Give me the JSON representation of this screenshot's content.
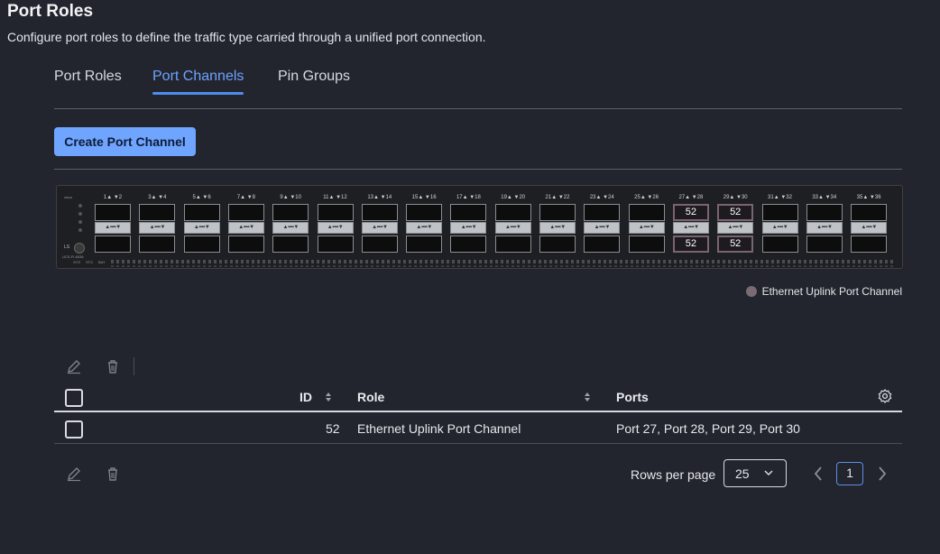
{
  "header": {
    "title": "Port Roles",
    "subtitle": "Configure port roles to define the traffic type carried through a unified port connection."
  },
  "tabs": [
    {
      "label": "Port Roles",
      "active": false
    },
    {
      "label": "Port Channels",
      "active": true
    },
    {
      "label": "Pin Groups",
      "active": false
    }
  ],
  "actions": {
    "create_label": "Create Port Channel"
  },
  "switch": {
    "model": "UCS-FI-6536",
    "ls_label": "LS",
    "led_labels": [
      "SYS",
      "STS",
      "BAY"
    ],
    "port_pairs": [
      {
        "label": "1▲ ▼2",
        "top": "",
        "bottom": ""
      },
      {
        "label": "3▲ ▼4",
        "top": "",
        "bottom": ""
      },
      {
        "label": "5▲ ▼6",
        "top": "",
        "bottom": ""
      },
      {
        "label": "7▲ ▼8",
        "top": "",
        "bottom": ""
      },
      {
        "label": "9▲ ▼10",
        "top": "",
        "bottom": ""
      },
      {
        "label": "11▲ ▼12",
        "top": "",
        "bottom": ""
      },
      {
        "label": "13▲ ▼14",
        "top": "",
        "bottom": ""
      },
      {
        "label": "15▲ ▼16",
        "top": "",
        "bottom": ""
      },
      {
        "label": "17▲ ▼18",
        "top": "",
        "bottom": ""
      },
      {
        "label": "19▲ ▼20",
        "top": "",
        "bottom": ""
      },
      {
        "label": "21▲ ▼22",
        "top": "",
        "bottom": ""
      },
      {
        "label": "23▲ ▼24",
        "top": "",
        "bottom": ""
      },
      {
        "label": "25▲ ▼26",
        "top": "",
        "bottom": ""
      },
      {
        "label": "27▲ ▼28",
        "top": "52",
        "bottom": "52"
      },
      {
        "label": "29▲ ▼30",
        "top": "52",
        "bottom": "52"
      },
      {
        "label": "31▲ ▼32",
        "top": "",
        "bottom": ""
      },
      {
        "label": "33▲ ▼34",
        "top": "",
        "bottom": ""
      },
      {
        "label": "35▲ ▼36",
        "top": "",
        "bottom": ""
      }
    ]
  },
  "legend": {
    "label": "Ethernet Uplink Port Channel",
    "color": "#7a6a74"
  },
  "table": {
    "columns": {
      "id": "ID",
      "role": "Role",
      "ports": "Ports"
    },
    "rows": [
      {
        "id": "52",
        "role": "Ethernet Uplink Port Channel",
        "ports": "Port 27, Port 28, Port 29, Port 30"
      }
    ]
  },
  "pagination": {
    "rows_per_page_label": "Rows per page",
    "rows_per_page_value": "25",
    "current_page": "1"
  },
  "colors": {
    "accent": "#6ea2ff",
    "button": "#6fa5ff",
    "background": "#22252d"
  }
}
